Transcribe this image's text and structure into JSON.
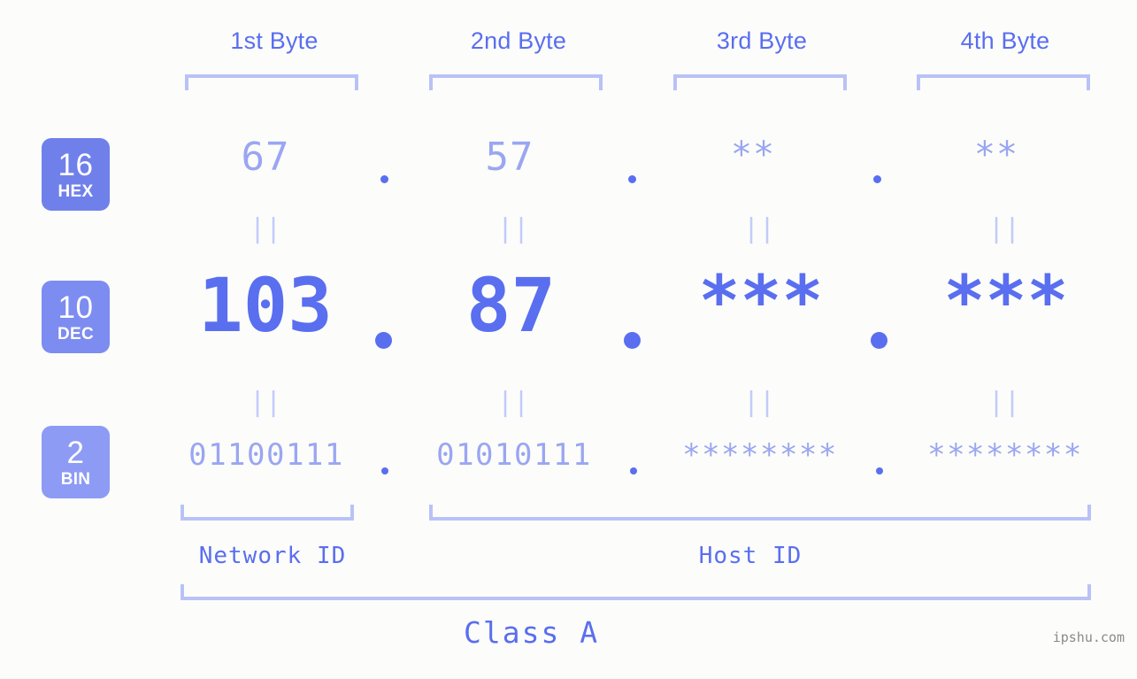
{
  "background_color": "#fcfdfa",
  "accent_color": "#5a6ef0",
  "muted_accent_color": "#9aa6f2",
  "bracket_color": "#b9c2f7",
  "byte_headers": [
    {
      "label": "1st Byte"
    },
    {
      "label": "2nd Byte"
    },
    {
      "label": "3rd Byte"
    },
    {
      "label": "4th Byte"
    }
  ],
  "bases": [
    {
      "number": "16",
      "name": "HEX",
      "color": "#7080ea"
    },
    {
      "number": "10",
      "name": "DEC",
      "color": "#7d8cf0"
    },
    {
      "number": "2",
      "name": "BIN",
      "color": "#8d9bf5"
    }
  ],
  "rows": {
    "hex": {
      "base_number": "16",
      "base_name": "HEX",
      "values": [
        "67",
        "57",
        "**",
        "**"
      ],
      "separator": "."
    },
    "dec": {
      "base_number": "10",
      "base_name": "DEC",
      "values": [
        "103",
        "87",
        "***",
        "***"
      ],
      "separator": "."
    },
    "bin": {
      "base_number": "2",
      "base_name": "BIN",
      "values": [
        "01100111",
        "01010111",
        "********",
        "********"
      ],
      "separator": "."
    }
  },
  "equivalence_marks": [
    "||",
    "||",
    "||",
    "||",
    "||",
    "||",
    "||",
    "||"
  ],
  "regions": [
    {
      "label": "Network ID"
    },
    {
      "label": "Host ID"
    }
  ],
  "class": {
    "label": "Class A"
  },
  "watermark": {
    "text": "ipshu.com"
  }
}
